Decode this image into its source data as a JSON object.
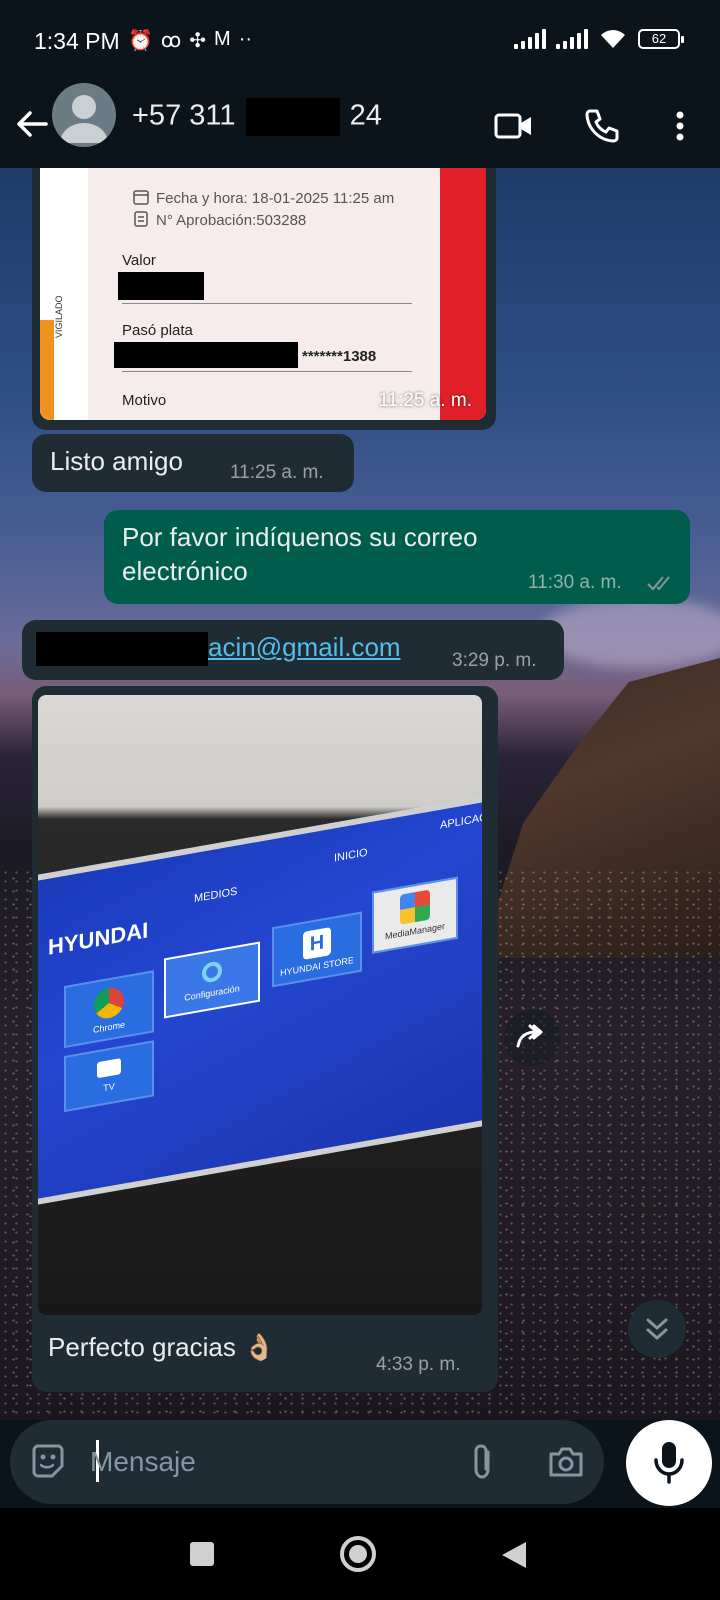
{
  "status_bar": {
    "time": "1:34 PM",
    "battery": "62"
  },
  "header": {
    "contact_prefix": "+57 311",
    "contact_suffix": "24"
  },
  "messages": {
    "receipt": {
      "datetime_line": "Fecha y hora: 18-01-2025 11:25 am",
      "approval_line": "N° Aprobación:503288",
      "value_label": "Valor",
      "paid_label": "Pasó plata",
      "paid_value_tail": "*******1388",
      "reason_label": "Motivo",
      "vertical_text": "VIGILADO",
      "time": "11:25 a. m."
    },
    "listo": {
      "text": "Listo amigo",
      "time": "11:25 a. m."
    },
    "correo": {
      "text": "Por favor indíquenos su correo electrónico",
      "time": "11:30 a. m."
    },
    "email": {
      "visible_part": "acin@gmail.com",
      "time": "3:29 p. m."
    },
    "photo": {
      "tv_brand": "HYUNDAI",
      "tv_menu_medios": "MEDIOS",
      "tv_menu_inicio": "INICIO",
      "tv_menu_aplicaciones": "APLICAC",
      "tv_app_chrome": "Chrome",
      "tv_app_config": "Configuración",
      "tv_app_store": "HYUNDAI STORE",
      "tv_app_media": "MediaManager",
      "tv_app_tv": "TV",
      "caption": "Perfecto gracias 👌🏼",
      "time": "4:33 p. m."
    }
  },
  "composer": {
    "placeholder": "Mensaje"
  },
  "icons": {
    "back": "arrow-left",
    "video": "video-camera",
    "call": "phone",
    "more": "vertical-dots",
    "emoji": "sticker",
    "attach": "paperclip",
    "camera": "camera",
    "mic": "microphone",
    "forward": "forward-arrow",
    "scroll_down": "double-chevron-down"
  }
}
